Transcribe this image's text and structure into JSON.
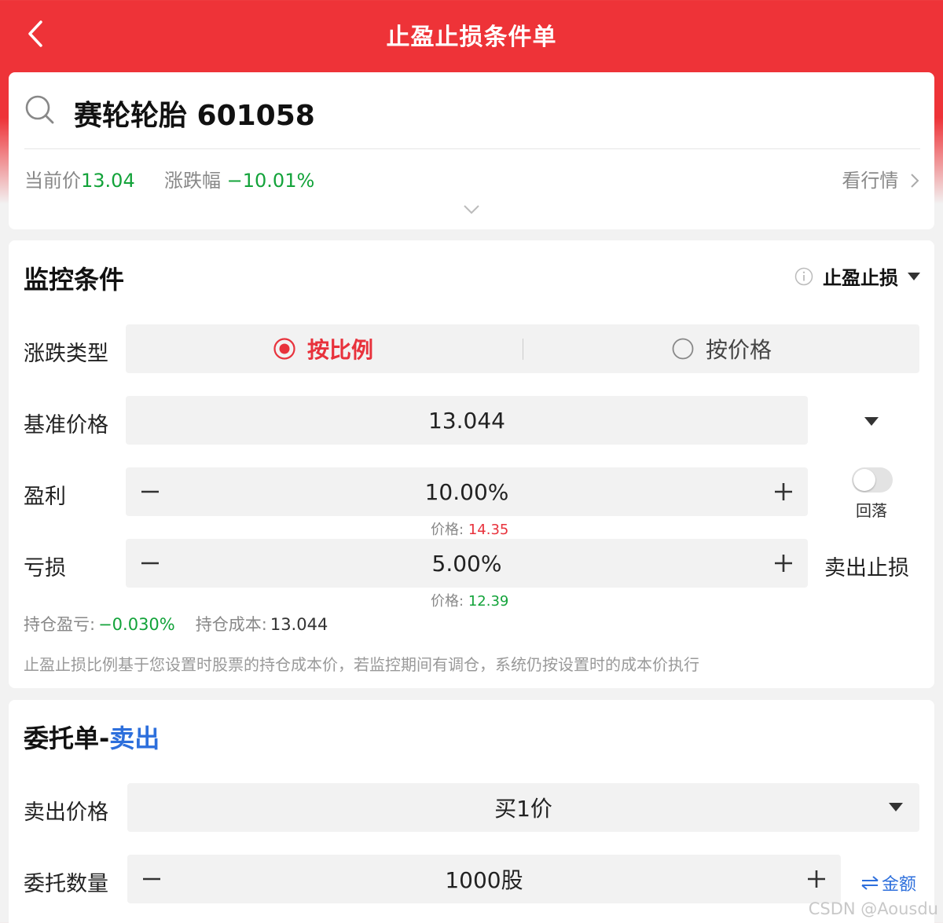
{
  "header": {
    "title": "止盈止损条件单"
  },
  "stock": {
    "name": "赛轮轮胎 601058",
    "current_price_label": "当前价",
    "current_price": "13.04",
    "change_label": "涨跌幅",
    "change": "−10.01%",
    "view_market": "看行情"
  },
  "monitor": {
    "title": "监控条件",
    "strategy": "止盈止损",
    "type_label": "涨跌类型",
    "type_options": [
      {
        "label": "按比例",
        "selected": true
      },
      {
        "label": "按价格",
        "selected": false
      }
    ],
    "base_price_label": "基准价格",
    "base_price": "13.044",
    "profit_label": "盈利",
    "profit_value": "10.00%",
    "profit_price_label": "价格:",
    "profit_price": "14.35",
    "toggle_label": "回落",
    "toggle_on": false,
    "loss_label": "亏损",
    "loss_value": "5.00%",
    "loss_price_label": "价格:",
    "loss_price": "12.39",
    "sell_stop": "卖出止损",
    "position_pnl_label": "持仓盈亏:",
    "position_pnl": "−0.030%",
    "position_cost_label": "持仓成本:",
    "position_cost": "13.044",
    "note": "止盈止损比例基于您设置时股票的持仓成本价，若监控期间有调仓，系统仍按设置时的成本价执行"
  },
  "order": {
    "title_prefix": "委托单-",
    "title_action": "卖出",
    "sell_price_label": "卖出价格",
    "sell_price": "买1价",
    "qty_label": "委托数量",
    "qty": "1000股",
    "amount_toggle": "金额"
  },
  "watermark": "CSDN @Aousdu",
  "colors": {
    "brand_red": "#ee3338",
    "up_red": "#e8323c",
    "down_green": "#13a33a",
    "link_blue": "#2d6fdc"
  }
}
